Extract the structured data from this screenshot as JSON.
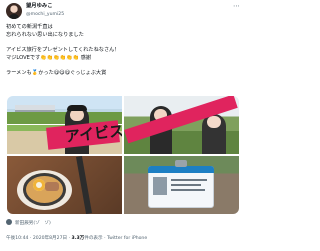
{
  "author": {
    "display_name": "望月ゆみこ",
    "handle": "@mochi_yumi25",
    "more_icon": "more-icon"
  },
  "tweet": {
    "lines": [
      "初めての新潟千直は",
      "忘れられない思い出になりました",
      "",
      "アイビス旅行をプレゼントしてくれたねなさん！",
      "マジLOVEです👏👏👏👏👏👏 感謝",
      "",
      "ラーメンも🥇かった😋😋😋ぐっじょぶ大賞"
    ]
  },
  "tagged": {
    "icon": "person-icon",
    "text": "新田辰男(ゾ　ゾ)"
  },
  "meta": {
    "time": "午後10:44",
    "date": "2020年8月27日",
    "views_count": "3.3万",
    "views_label": "件の表示",
    "client": "Twitter for iPhone",
    "separator": "·"
  },
  "media": {
    "towel_text": "アイビス"
  }
}
